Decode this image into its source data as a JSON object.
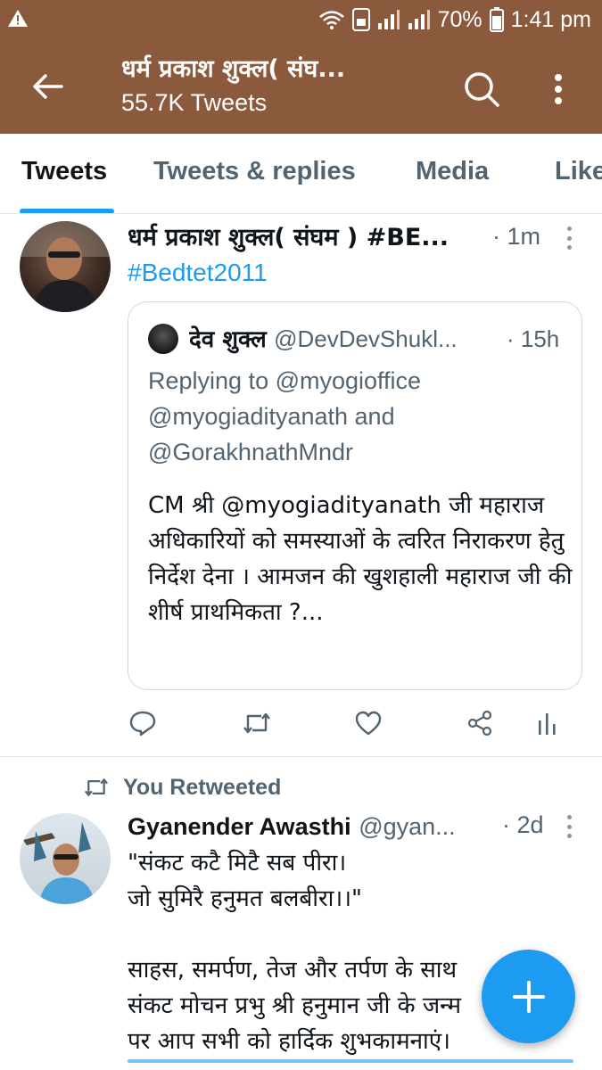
{
  "status_bar": {
    "battery": "70%",
    "time": "1:41 pm",
    "icons": [
      "warning-icon",
      "wifi-icon",
      "volte-icon",
      "signal-icon",
      "signal-icon",
      "battery-icon"
    ]
  },
  "header": {
    "title": "धर्म प्रकाश शुक्ल( संघ...",
    "subtitle": "55.7K Tweets",
    "icons": [
      "back-arrow-icon",
      "search-icon",
      "more-vert-icon"
    ]
  },
  "tabs": [
    {
      "label": "Tweets",
      "active": true
    },
    {
      "label": "Tweets & replies",
      "active": false
    },
    {
      "label": "Media",
      "active": false
    },
    {
      "label": "Like",
      "active": false
    }
  ],
  "tweet1": {
    "name": "धर्म प्रकाश शुक्ल( संघम ) #BE...",
    "time": "· 1m",
    "text": "#Bedtet2011",
    "quote": {
      "name": "देव शुक्ल",
      "handle": "@DevDevShukl...",
      "time": "· 15h",
      "reply_prefix": "Replying to ",
      "reply_mentions": "@myogioffice @myogiadityanath and @GorakhnathMndr",
      "text": "CM श्री @myogiadityanath जी महाराज अधिकारियों को समस्याओं के त्वरित निराकरण हेतु निर्देश देना । आमजन की खुशहाली महाराज जी की शीर्ष प्राथमिकता  ?..."
    },
    "actions": [
      "reply-icon",
      "retweet-icon",
      "like-icon",
      "share-icon",
      "analytics-icon"
    ]
  },
  "tweet2": {
    "social_context": "You Retweeted",
    "name": "Gyanender Awasthi",
    "handle": "@gyan...",
    "time": "· 2d",
    "text": "\"संकट कटै मिटै सब पीरा।\nजो सुमिरै हनुमत बलबीरा।।\"\n\nसाहस, समर्पण, तेज और तर्पण के साथ\nसंकट मोचन प्रभु श्री हनुमान जी के जन्म\nपर आप सभी को हार्दिक शुभकामनाएं।"
  },
  "fab": {
    "icon": "plus-icon",
    "label": "+"
  },
  "colors": {
    "app_bar": "#8b5a3c",
    "accent": "#1d9bf0",
    "muted": "#536471"
  }
}
